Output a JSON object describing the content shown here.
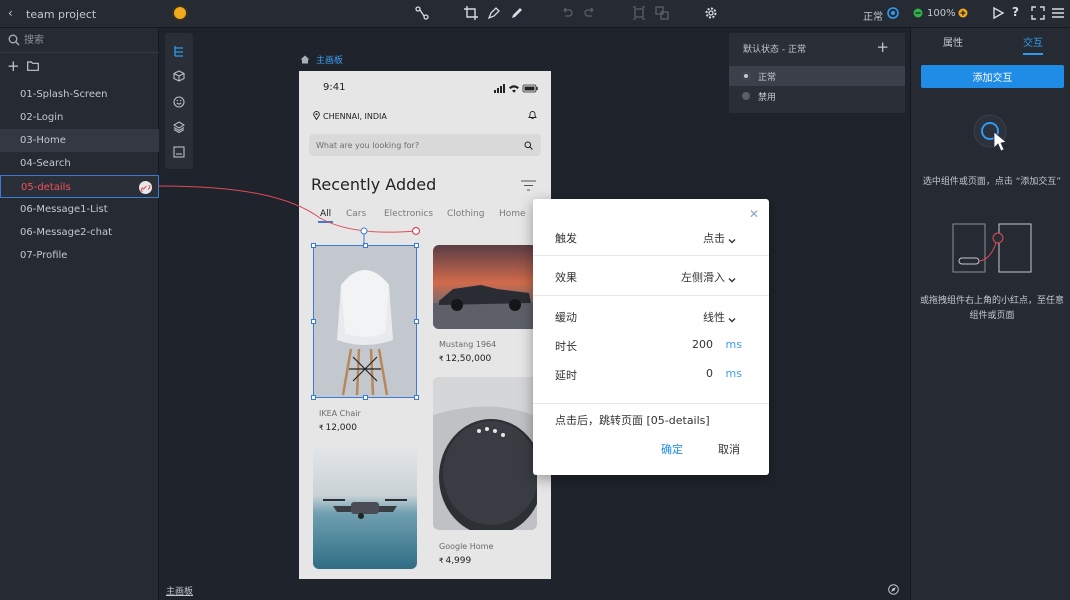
{
  "app": {
    "project_name": "team project",
    "zoom": "100%",
    "mode_label": "正常",
    "colors": {
      "accent": "#2e9bf0",
      "selected_page": "#f0525a",
      "link_line": "#e04a58",
      "bg": "#1f232b",
      "panel": "#262a33"
    }
  },
  "left": {
    "search_placeholder": "搜索",
    "pages": [
      {
        "label": "01-Splash-Screen"
      },
      {
        "label": "02-Login"
      },
      {
        "label": "03-Home"
      },
      {
        "label": "04-Search"
      },
      {
        "label": "05-details"
      },
      {
        "label": "06-Message1-List"
      },
      {
        "label": "06-Message2-chat"
      },
      {
        "label": "07-Profile"
      }
    ]
  },
  "canvas": {
    "artboard_label": "主画板",
    "bottom_label": "主画板"
  },
  "phone": {
    "time": "9:41",
    "location": "CHENNAI, INDIA",
    "search_placeholder": "What are you looking for?",
    "title": "Recently Added",
    "tabs": [
      "All",
      "Cars",
      "Electronics",
      "Clothing",
      "Home"
    ],
    "active_tab": "All",
    "cards": [
      {
        "name": "IKEA Chair",
        "currency": "₹",
        "price": "12,000"
      },
      {
        "name": "Mustang 1964",
        "currency": "₹",
        "price": "12,50,000"
      },
      {
        "name": "Google Home",
        "currency": "₹",
        "price": "4,999"
      }
    ]
  },
  "state_panel": {
    "header": "默认状态 - 正常",
    "states": [
      {
        "label": "正常",
        "active": true
      },
      {
        "label": "禁用",
        "active": false
      }
    ]
  },
  "right": {
    "tab_properties": "属性",
    "tab_interactions": "交互",
    "add_button": "添加交互",
    "hint1": "选中组件或页面，点击 “添加交互”",
    "hint2": "或拖拽组件右上角的小红点，至任意组件或页面"
  },
  "dialog": {
    "trigger_label": "触发",
    "trigger_value": "点击",
    "effect_label": "效果",
    "effect_value": "左侧滑入",
    "easing_label": "缓动",
    "easing_value": "线性",
    "duration_label": "时长",
    "duration_value": "200",
    "delay_label": "延时",
    "delay_value": "0",
    "unit": "ms",
    "note": "点击后，跳转页面 [05-details]",
    "ok": "确定",
    "cancel": "取消"
  }
}
